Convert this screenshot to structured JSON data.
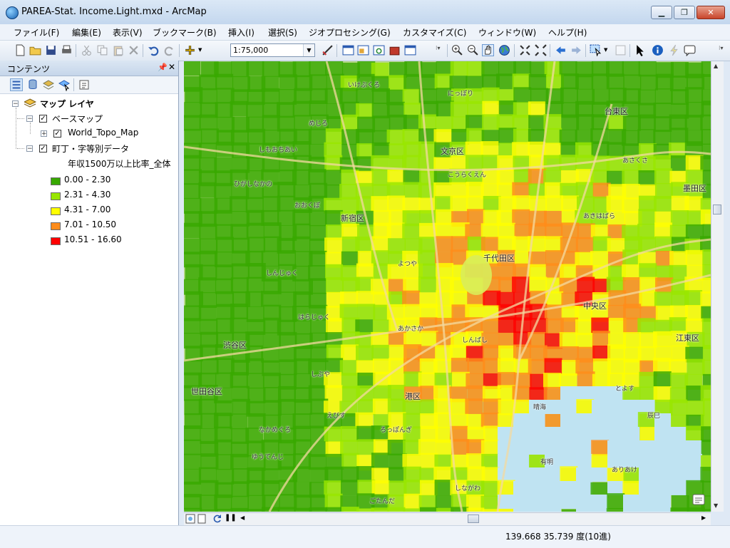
{
  "window": {
    "title": "PAREA-Stat.  Income.Light.mxd - ArcMap"
  },
  "menu": [
    "ファイル(F)",
    "編集(E)",
    "表示(V)",
    "ブックマーク(B)",
    "挿入(I)",
    "選択(S)",
    "ジオプロセシング(G)",
    "カスタマイズ(C)",
    "ウィンドウ(W)",
    "ヘルプ(H)"
  ],
  "toolbar": {
    "scale": "1:75,000"
  },
  "toc": {
    "title": "コンテンツ",
    "root_label": "マップ レイヤ",
    "group_basemap": "ベースマップ",
    "layer_topo": "World_Topo_Map",
    "layer_data": "町丁・字等別データ",
    "field_label": "年収1500万以上比率_全体",
    "legend": [
      {
        "label": "0.00 - 2.30",
        "color": "#38a800"
      },
      {
        "label": "2.31 - 4.30",
        "color": "#98e600"
      },
      {
        "label": "4.31 - 7.00",
        "color": "#ffff00"
      },
      {
        "label": "7.01 - 10.50",
        "color": "#ff8c1a"
      },
      {
        "label": "10.51 - 16.60",
        "color": "#ff0000"
      }
    ]
  },
  "map": {
    "labels": [
      "世田谷区",
      "渋谷区",
      "新宿区",
      "文京区",
      "千代田区",
      "中央区",
      "港区",
      "江東区",
      "台東区",
      "墨田区",
      "しもおちあい",
      "ひがしなかの",
      "おおくぼ",
      "しんじゅく",
      "はらじゅく",
      "しぶや",
      "あかさか",
      "ろっぽんぎ",
      "しんばし",
      "とよす",
      "ありあけ",
      "にっぽり",
      "あさくさ",
      "あきはばら",
      "ごたんだ",
      "しながわ",
      "えびす",
      "めじろ",
      "いけぶくろ",
      "ゆうてんじ",
      "なかめぐろ",
      "よつや",
      "こうらくえん",
      "晴海",
      "有明",
      "辰巳"
    ]
  },
  "status": {
    "coords": "139.668  35.739 度(10進)"
  }
}
